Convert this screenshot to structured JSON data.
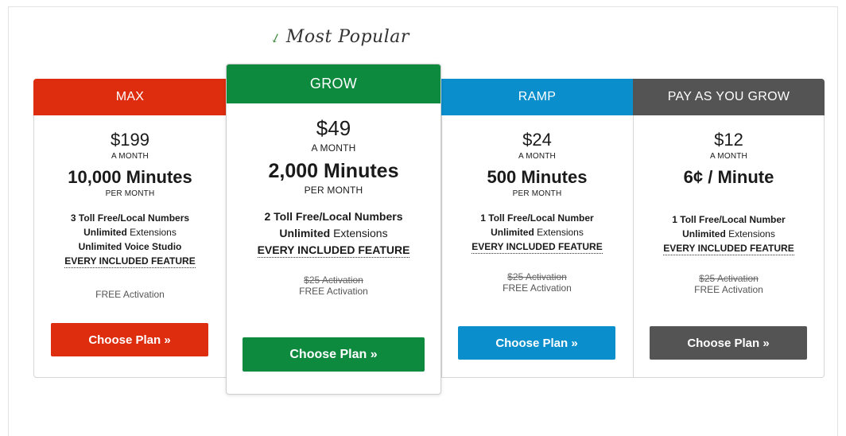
{
  "popular_label": "Most Popular",
  "colors": {
    "max": "#dd2c0e",
    "grow": "#0e8a3f",
    "ramp": "#0a8fcc",
    "payg": "#545454"
  },
  "plans": {
    "max": {
      "name": "MAX",
      "price": "$199",
      "per_month": "A MONTH",
      "minutes": "10,000 Minutes",
      "minutes_unit": "PER MONTH",
      "f1_bold": "3 Toll Free/Local Numbers",
      "f2_bold": "Unlimited",
      "f2_rest": " Extensions",
      "f3_bold": "Unlimited Voice Studio",
      "every": "EVERY INCLUDED FEATURE",
      "activation": "FREE Activation",
      "button": "Choose Plan »"
    },
    "grow": {
      "name": "GROW",
      "price": "$49",
      "per_month": "A MONTH",
      "minutes": "2,000 Minutes",
      "minutes_unit": "PER MONTH",
      "f1_bold": "2 Toll Free/Local Numbers",
      "f2_bold": "Unlimited",
      "f2_rest": " Extensions",
      "every": "EVERY INCLUDED FEATURE",
      "old_activation": "$25 Activation",
      "activation": "FREE Activation",
      "button": "Choose Plan »"
    },
    "ramp": {
      "name": "RAMP",
      "price": "$24",
      "per_month": "A MONTH",
      "minutes": "500 Minutes",
      "minutes_unit": "PER MONTH",
      "f1_bold": "1 Toll Free/Local Number",
      "f2_bold": "Unlimited",
      "f2_rest": " Extensions",
      "every": "EVERY INCLUDED FEATURE",
      "old_activation": "$25 Activation",
      "activation": "FREE Activation",
      "button": "Choose Plan »"
    },
    "payg": {
      "name": "PAY AS YOU GROW",
      "price": "$12",
      "per_month": "A MONTH",
      "minutes": "6¢ / Minute",
      "f1_bold": "1 Toll Free/Local Number",
      "f2_bold": "Unlimited",
      "f2_rest": " Extensions",
      "every": "EVERY INCLUDED FEATURE",
      "old_activation": "$25 Activation",
      "activation": "FREE Activation",
      "button": "Choose Plan »"
    }
  }
}
